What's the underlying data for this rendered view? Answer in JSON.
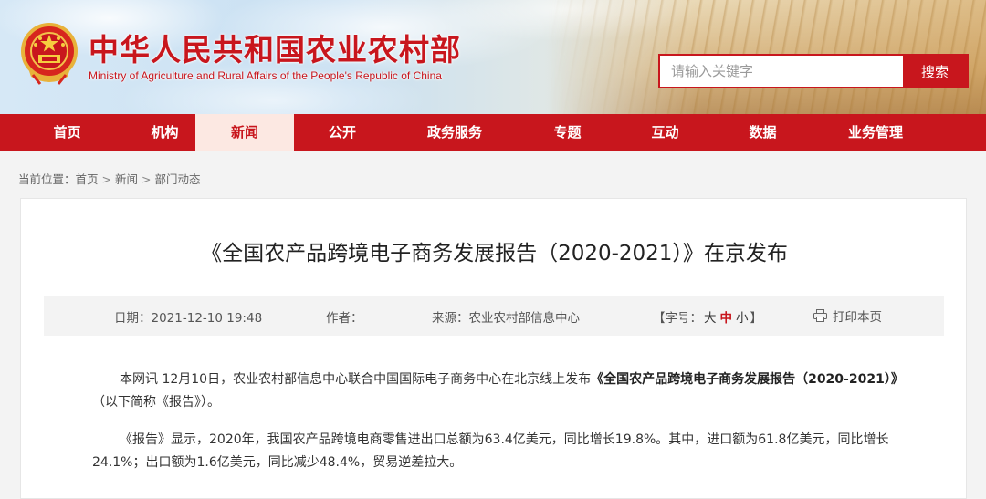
{
  "header": {
    "title": "中华人民共和国农业农村部",
    "subtitle": "Ministry of Agriculture and Rural Affairs of the People's Republic of China",
    "emblem_icon": "national-emblem-icon",
    "search": {
      "placeholder": "请输入关键字",
      "button_label": "搜索"
    }
  },
  "nav": {
    "items": [
      {
        "label": "首页"
      },
      {
        "label": "机构"
      },
      {
        "label": "新闻",
        "active": true
      },
      {
        "label": "公开"
      },
      {
        "label": "政务服务"
      },
      {
        "label": "专题"
      },
      {
        "label": "互动"
      },
      {
        "label": "数据"
      },
      {
        "label": "业务管理"
      }
    ]
  },
  "breadcrumb": {
    "prefix": "当前位置：",
    "items": [
      "首页",
      "新闻",
      "部门动态"
    ],
    "separator": ">"
  },
  "article": {
    "title": "《全国农产品跨境电子商务发展报告（2020-2021）》在京发布",
    "meta": {
      "date_label": "日期：",
      "date": "2021-12-10 19:48",
      "author_label": "作者：",
      "author": "",
      "source_label": "来源：",
      "source": "农业农村部信息中心",
      "font_size_label_open": "【字号：",
      "font_sizes": [
        "大",
        "中",
        "小"
      ],
      "font_size_label_close": "】",
      "print_label": "打印本页",
      "print_icon": "printer-icon"
    },
    "paragraphs": [
      {
        "text_before": "本网讯 12月10日，农业农村部信息中心联合中国国际电子商务中心在北京线上发布",
        "bold": "《全国农产品跨境电子商务发展报告（2020-2021）》",
        "text_after": "（以下简称《报告》）。"
      },
      {
        "text_before": "《报告》显示，2020年，我国农产品跨境电商零售进出口总额为63.4亿美元，同比增长19.8%。其中，进口额为61.8亿美元，同比增长24.1%；出口额为1.6亿美元，同比减少48.4%，贸易逆差拉大。",
        "bold": "",
        "text_after": ""
      }
    ]
  },
  "colors": {
    "brand_red": "#c8161d",
    "nav_active_bg": "#fce8e2",
    "meta_bg": "#f3f3f3"
  }
}
